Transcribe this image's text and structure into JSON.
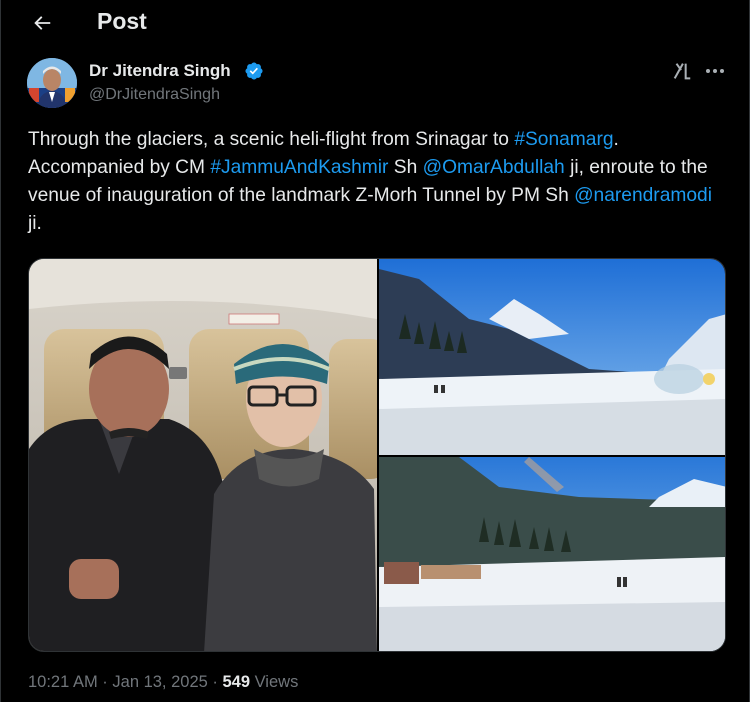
{
  "header": {
    "title": "Post",
    "back_icon": "arrow-left-icon"
  },
  "author": {
    "name": "Dr Jitendra Singh",
    "handle": "@DrJitendraSingh",
    "verified_color": "#1d9bf0"
  },
  "tweet": {
    "segments": [
      {
        "text": "Through the glaciers, a scenic heli-flight from Srinagar to ",
        "link": false
      },
      {
        "text": "#Sonamarg",
        "link": true
      },
      {
        "text": ". Accompanied by CM ",
        "link": false
      },
      {
        "text": "#JammuAndKashmir",
        "link": true
      },
      {
        "text": " Sh ",
        "link": false
      },
      {
        "text": "@OmarAbdullah",
        "link": true
      },
      {
        "text": " ji, enroute to the venue of inauguration of the landmark Z-Morh Tunnel by PM Sh ",
        "link": false
      },
      {
        "text": "@narendramodi",
        "link": true
      },
      {
        "text": " ji.",
        "link": false
      }
    ]
  },
  "media": [
    {
      "name": "photo-selfie-helicopter"
    },
    {
      "name": "photo-snow-valley"
    },
    {
      "name": "photo-helipad-snowfield"
    }
  ],
  "meta": {
    "time": "10:21 AM",
    "sep1": " · ",
    "date": "Jan 13, 2025",
    "sep2": " · ",
    "views_count": "549",
    "views_label": " Views"
  },
  "colors": {
    "link": "#1d9bf0",
    "muted": "#71767b",
    "text": "#e7e9ea",
    "background": "#000000"
  }
}
